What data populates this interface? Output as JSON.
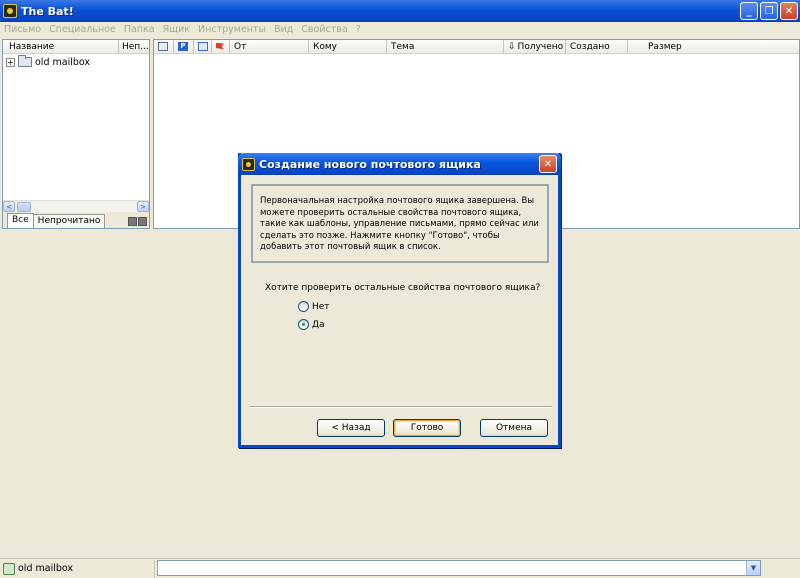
{
  "window": {
    "title": "The Bat!",
    "controls": {
      "minimize": "_",
      "maximize": "❐",
      "close": "✕"
    }
  },
  "menu": [
    "Письмо",
    "Специальное",
    "Папка",
    "Ящик",
    "Инструменты",
    "Вид",
    "Свойства",
    "?"
  ],
  "folder_pane": {
    "columns": [
      "Название",
      "Неп..."
    ],
    "items": [
      {
        "expander": "+",
        "label": "old mailbox"
      }
    ],
    "tabs": [
      "Все",
      "Непрочитано"
    ],
    "scroll_left": "<",
    "scroll_right": ">"
  },
  "message_list": {
    "columns": {
      "from": "От",
      "to": "Кому",
      "subject": "Тема",
      "received": "Получено",
      "created": "Создано",
      "size": "Размер"
    },
    "icons": {
      "p": "P"
    },
    "sort_indicator": "⇩"
  },
  "dialog": {
    "title": "Создание нового почтового ящика",
    "close": "✕",
    "info_text": "Первоначальная настройка почтового ящика завершена. Вы можете проверить остальные свойства почтового ящика, такие как шаблоны, управление письмами, прямо сейчас или сделать это позже. Нажмите кнопку \"Готово\", чтобы добавить этот почтовый ящик в список.",
    "question": "Хотите проверить остальные свойства почтового ящика?",
    "options": [
      {
        "label": "Нет",
        "selected": false
      },
      {
        "label": "Да",
        "selected": true
      }
    ],
    "buttons": {
      "back": "< Назад",
      "finish": "Готово",
      "cancel": "Отмена"
    }
  },
  "statusbar": {
    "mailbox": "old mailbox",
    "combo_value": "",
    "dropdown": "▼"
  },
  "colors": {
    "titlebar": "#0a52d6",
    "dialog_border": "#0a46c8",
    "background": "#ece9d8"
  }
}
